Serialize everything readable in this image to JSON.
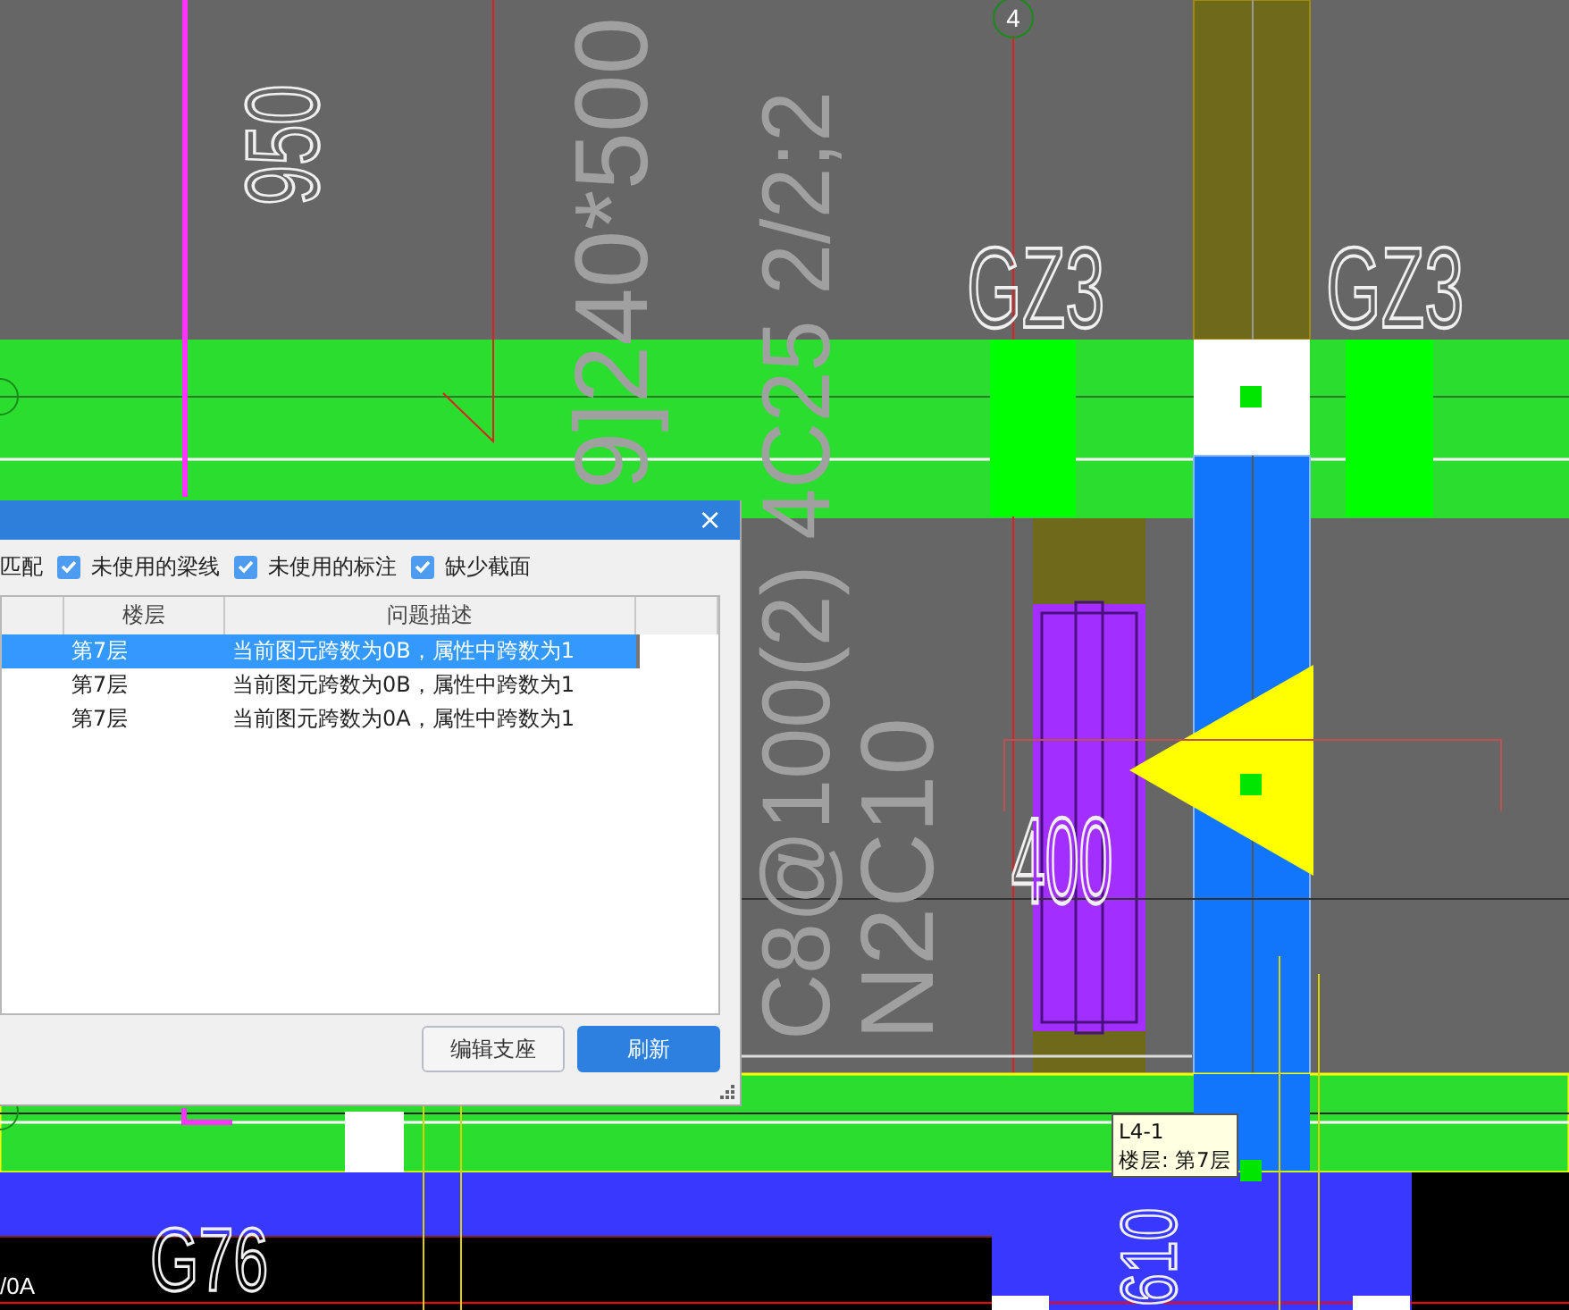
{
  "drawing": {
    "axis_markers": [
      "4"
    ],
    "labels": [
      {
        "text": "950",
        "kind": "outline-vertical"
      },
      {
        "text": "9]240*500",
        "kind": "big-vertical"
      },
      {
        "text": "C8@100(2) 4C25 2/2;2",
        "kind": "big-vertical"
      },
      {
        "text": "N2C10",
        "kind": "big-vertical"
      },
      {
        "text": "GZ3",
        "kind": "outline"
      },
      {
        "text": "GZ3",
        "kind": "outline"
      },
      {
        "text": "400",
        "kind": "outline"
      },
      {
        "text": "G76",
        "kind": "outline"
      },
      {
        "text": "610",
        "kind": "outline-vertical"
      },
      {
        "text": "/0A",
        "kind": "axis-note"
      }
    ]
  },
  "dialog": {
    "close": "×",
    "filters": [
      {
        "label": "匹配"
      },
      {
        "label": "未使用的梁线",
        "checked": true
      },
      {
        "label": "未使用的标注",
        "checked": true
      },
      {
        "label": "缺少截面",
        "checked": true
      }
    ],
    "table": {
      "columns": [
        "楼层",
        "问题描述"
      ],
      "rows": [
        {
          "floor": "第7层",
          "description": "当前图元跨数为0B，属性中跨数为1",
          "selected": true
        },
        {
          "floor": "第7层",
          "description": "当前图元跨数为0B，属性中跨数为1",
          "selected": false
        },
        {
          "floor": "第7层",
          "description": "当前图元跨数为0A，属性中跨数为1",
          "selected": false
        }
      ]
    },
    "buttons": [
      {
        "label": "编辑支座",
        "kind": "secondary"
      },
      {
        "label": "刷新",
        "kind": "primary"
      }
    ]
  },
  "tooltip": {
    "title": "L4-1",
    "detail": "楼层: 第7层"
  }
}
